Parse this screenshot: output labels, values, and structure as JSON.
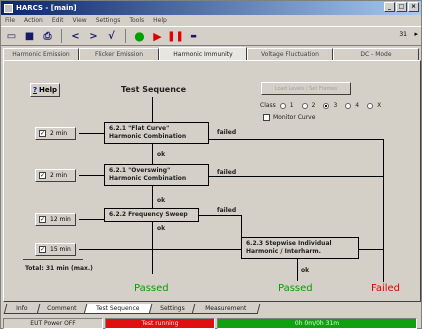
{
  "window": {
    "title": "HARCS - [main]",
    "buttons": [
      "_",
      "□",
      "×"
    ]
  },
  "menu": [
    "File",
    "Action",
    "Edit",
    "View",
    "Settings",
    "Tools",
    "Help"
  ],
  "toolbar": {
    "icons": [
      "open-icon",
      "save-icon",
      "print-icon",
      "back-icon",
      "forward-icon",
      "check-icon",
      "stop-icon",
      "play-icon",
      "pause-icon",
      "monitor-icon"
    ],
    "zoom": "31",
    "arrow": "▸"
  },
  "top_tabs": [
    {
      "label": "Harmonic Emission",
      "active": false
    },
    {
      "label": "Flicker Emission",
      "active": false
    },
    {
      "label": "Harmonic Immunity",
      "active": true
    },
    {
      "label": "Voltage Fluctuation",
      "active": false
    },
    {
      "label": "DC - Mode",
      "active": false
    }
  ],
  "help_button": {
    "icon": "?",
    "label": "Help"
  },
  "sequence_title": "Test Sequence",
  "limits_button": "Load Levels / Set Frames",
  "class_row": {
    "label": "Class",
    "options": [
      "1",
      "2",
      "3",
      "4",
      "X"
    ],
    "selected": "3"
  },
  "monitor_curve": {
    "label": "Monitor Curve",
    "checked": false
  },
  "steps": [
    {
      "time": "2 min",
      "checked": true,
      "title_line1": "6.2.1 \"Flat Curve\"",
      "title_line2": "Harmonic Combination",
      "fail_label": "failed",
      "ok_label": "ok"
    },
    {
      "time": "2 min",
      "checked": true,
      "title_line1": "6.2.1 \"Overswing\"",
      "title_line2": "Harmonic Combination",
      "fail_label": "failed",
      "ok_label": "ok"
    },
    {
      "time": "12 min",
      "checked": true,
      "title_line1": "6.2.2 Frequency Sweep",
      "title_line2": "",
      "fail_label": "failed",
      "ok_label": "ok"
    },
    {
      "time": "15 min",
      "checked": true,
      "title_line1": "6.2.3 Stepwise Individual",
      "title_line2": "Harmonic / Interharm.",
      "fail_label": "",
      "ok_label": "ok"
    }
  ],
  "total": "Total:    31 min (max.)",
  "results": {
    "passed_left": "Passed",
    "passed_right": "Passed",
    "failed": "Failed"
  },
  "bottom_tabs": [
    {
      "label": "Info",
      "active": false
    },
    {
      "label": "Comment",
      "active": false
    },
    {
      "label": "Test Sequence",
      "active": true
    },
    {
      "label": "Settings",
      "active": false
    },
    {
      "label": "Measurement",
      "active": false
    }
  ],
  "status": {
    "power": "EUT Power OFF",
    "test": "Test running",
    "remaining": "0h 0m/0h 31m"
  },
  "colors": {
    "green": "#00a000",
    "red": "#e00000",
    "status_red": "#e01010",
    "status_green": "#10a010"
  }
}
